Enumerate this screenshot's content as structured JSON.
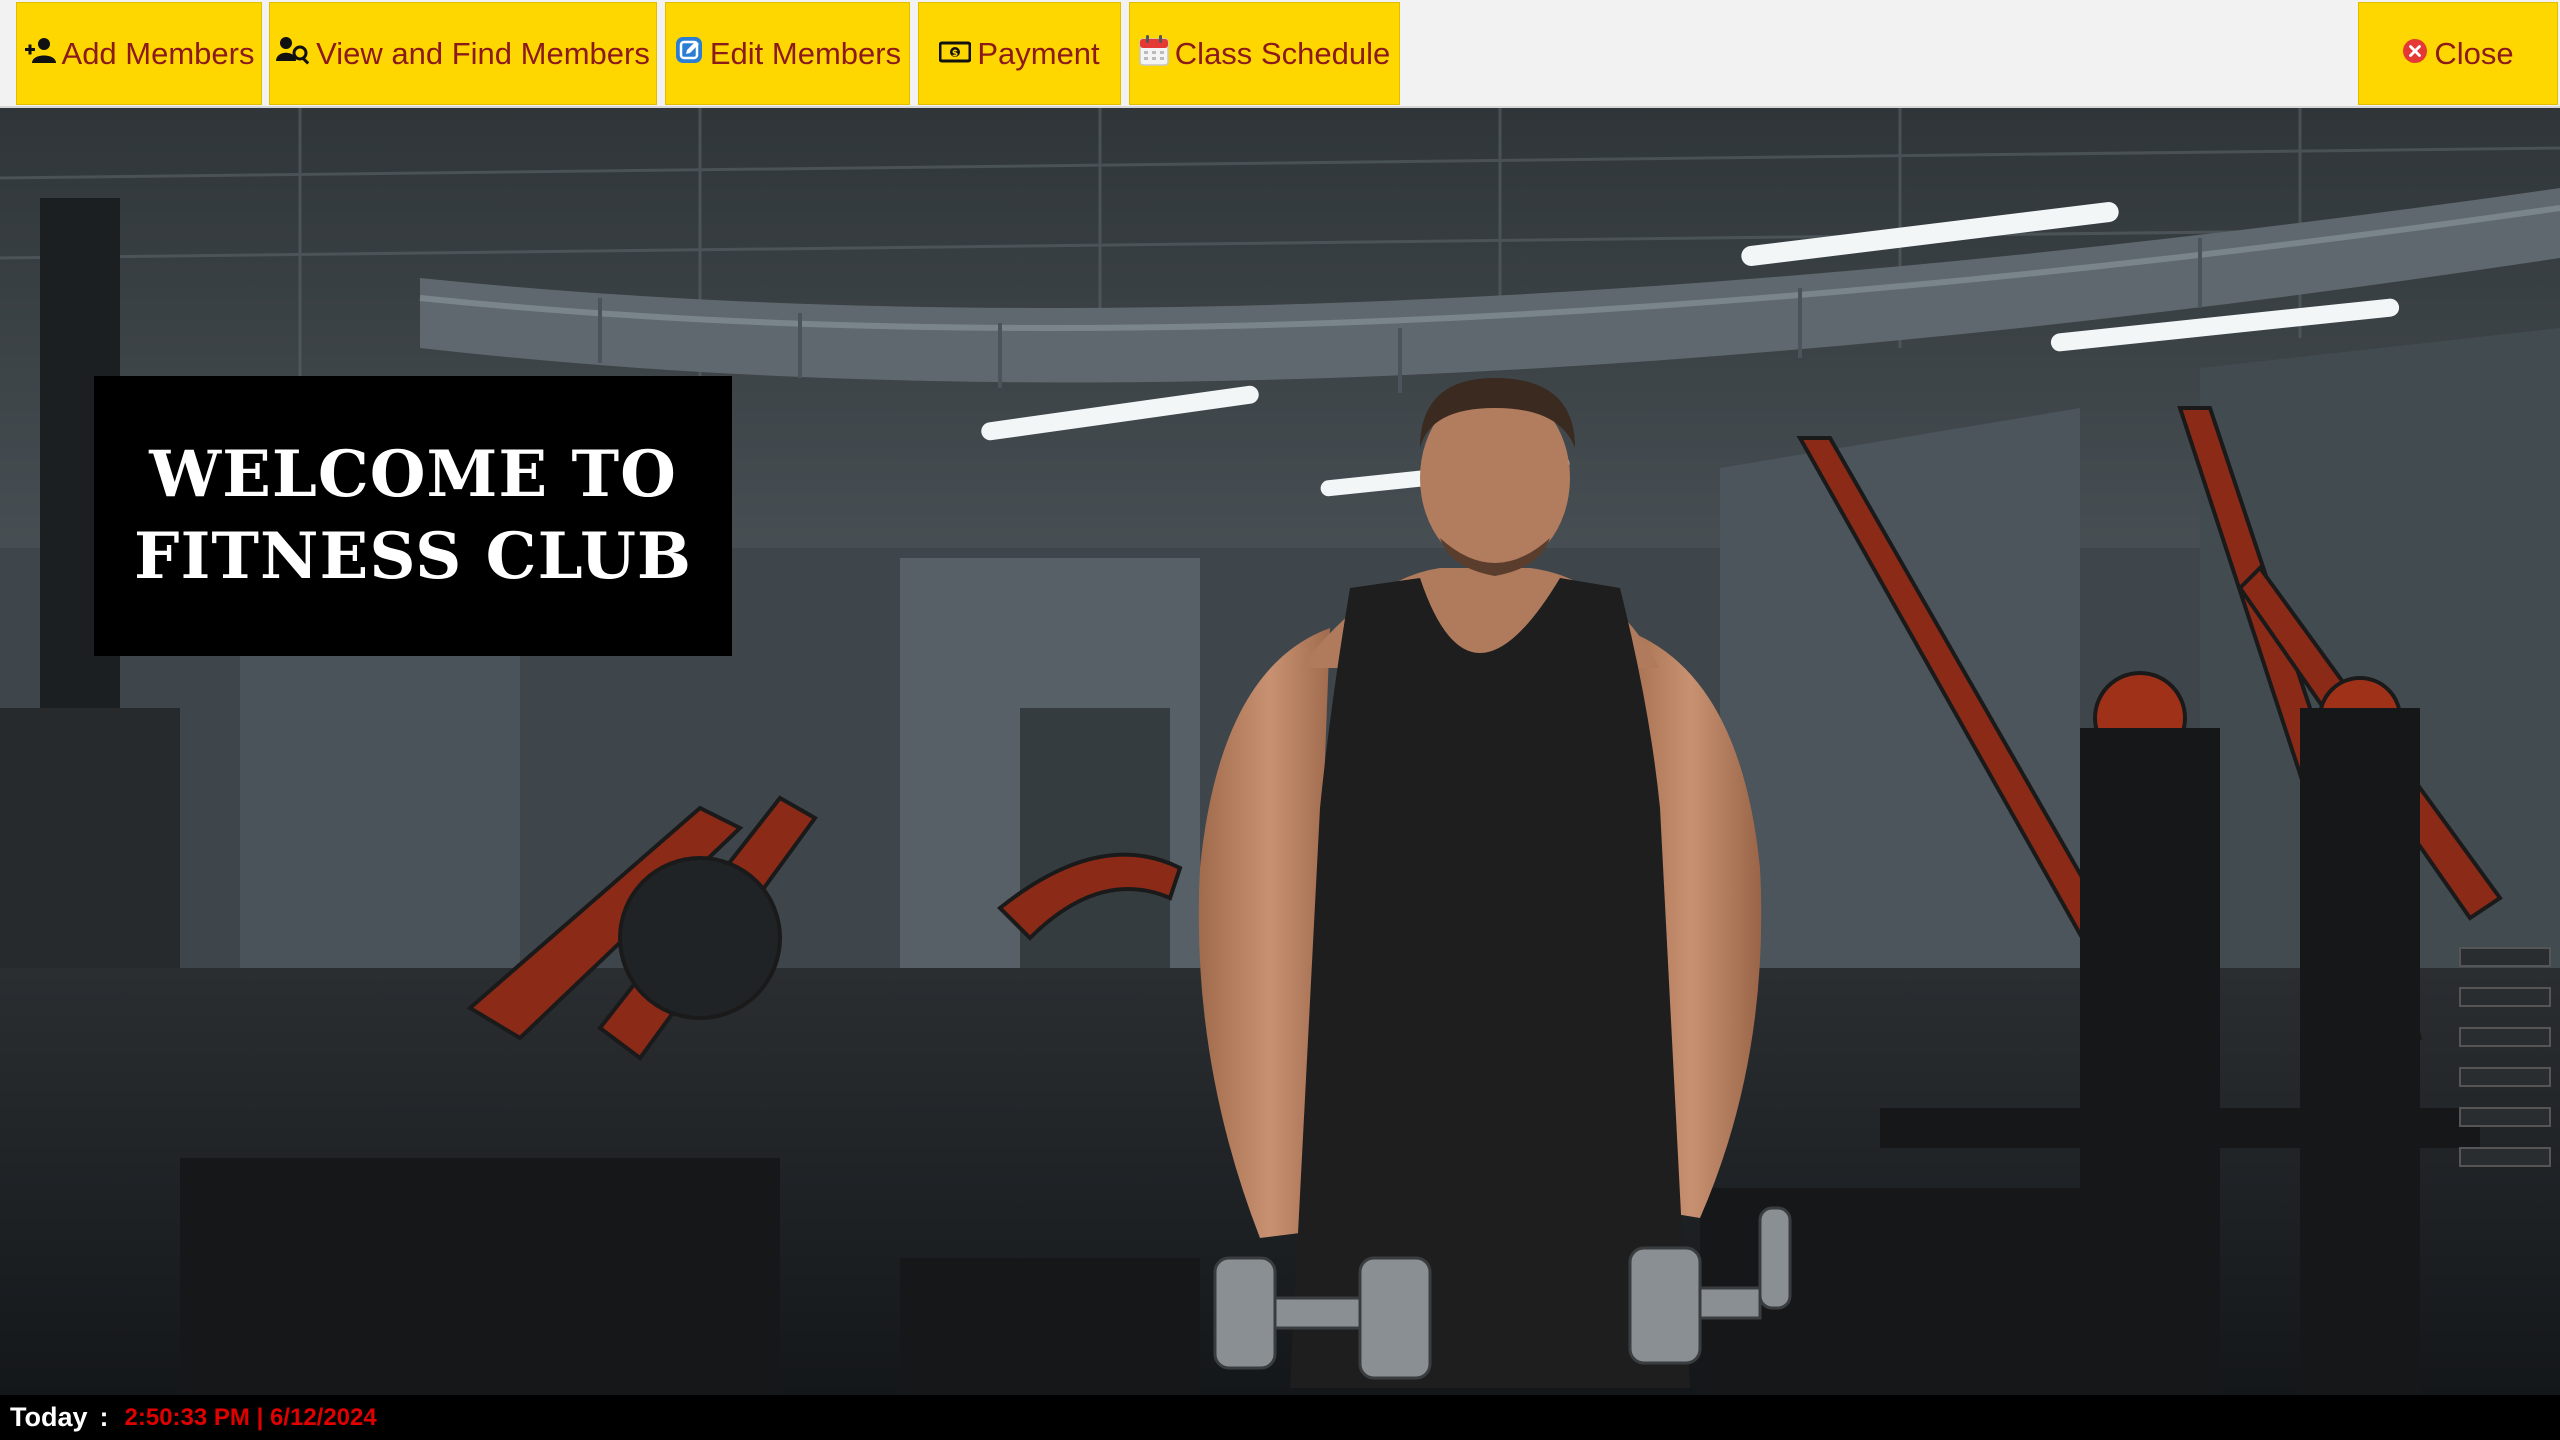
{
  "toolbar": {
    "add_members": "Add Members",
    "view_find_members": "View and Find Members",
    "edit_members": "Edit Members",
    "payment": "Payment",
    "class_schedule": "Class Schedule",
    "close": "Close"
  },
  "welcome": {
    "line1": "WELCOME TO",
    "line2": "FITNESS CLUB"
  },
  "status": {
    "label": "Today",
    "separator": ":",
    "datetime": "2:50:33 PM | 6/12/2024"
  },
  "colors": {
    "toolbar_button_bg": "#ffd700",
    "toolbar_button_text": "#8b1a1a",
    "status_value": "#e00000"
  },
  "icons": {
    "add_members": "user-plus-icon",
    "view_find_members": "users-search-icon",
    "edit_members": "edit-icon",
    "payment": "money-bill-icon",
    "class_schedule": "calendar-icon",
    "close": "close-circle-icon"
  }
}
